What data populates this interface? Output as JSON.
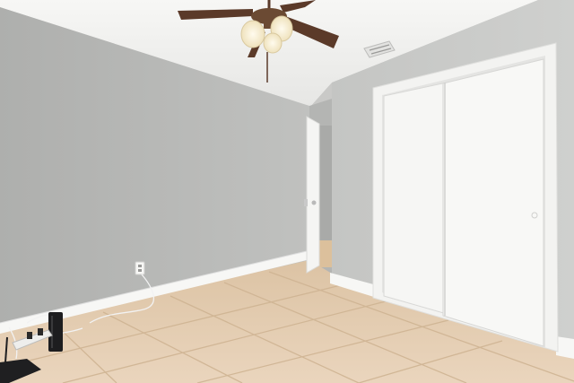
{
  "scene": {
    "subject": "empty bedroom",
    "colors": {
      "wall": "#b7b8b6",
      "right_wall": "#c3c4c2",
      "ceiling": "#f1f1ef",
      "floor_tile": "#e3cdb2",
      "grout": "#d2b999",
      "trim": "#ffffff",
      "closet_door": "#f6f6f4",
      "fan_blade": "#5a3a2a",
      "fan_body": "#6b4a33",
      "light_glass": "#fff7df"
    },
    "icons": [
      "ceiling-fan-icon",
      "light-fixture-icon",
      "air-vent-icon",
      "wall-outlet-icon",
      "router-icon",
      "power-strip-icon"
    ]
  }
}
